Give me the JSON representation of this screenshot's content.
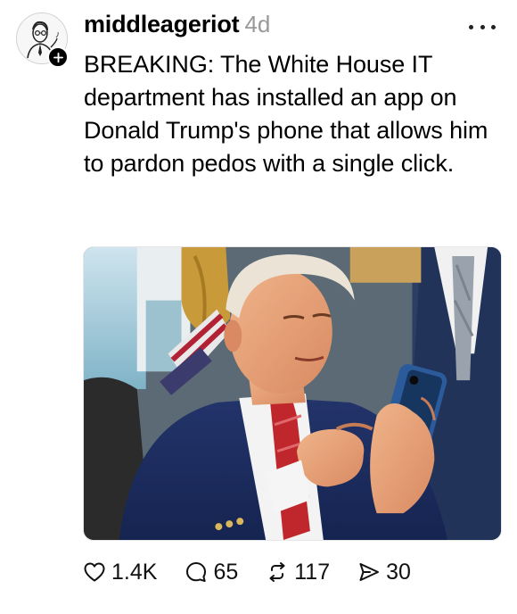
{
  "post": {
    "author": {
      "username": "middleageriot",
      "timestamp": "4d",
      "avatar_icon": "sketch-portrait-avatar",
      "follow_icon": "plus-icon"
    },
    "menu_icon": "more-horizontal-icon",
    "text": "BREAKING: The White House IT department has installed an app on Donald Trump's phone that allows him to pardon pedos with a single click.",
    "image": {
      "description_icon": "photo"
    },
    "actions": [
      {
        "name": "like",
        "icon": "heart-icon",
        "count": "1.4K"
      },
      {
        "name": "reply",
        "icon": "comment-icon",
        "count": "65"
      },
      {
        "name": "repost",
        "icon": "repost-icon",
        "count": "117"
      },
      {
        "name": "share",
        "icon": "send-icon",
        "count": "30"
      }
    ]
  }
}
